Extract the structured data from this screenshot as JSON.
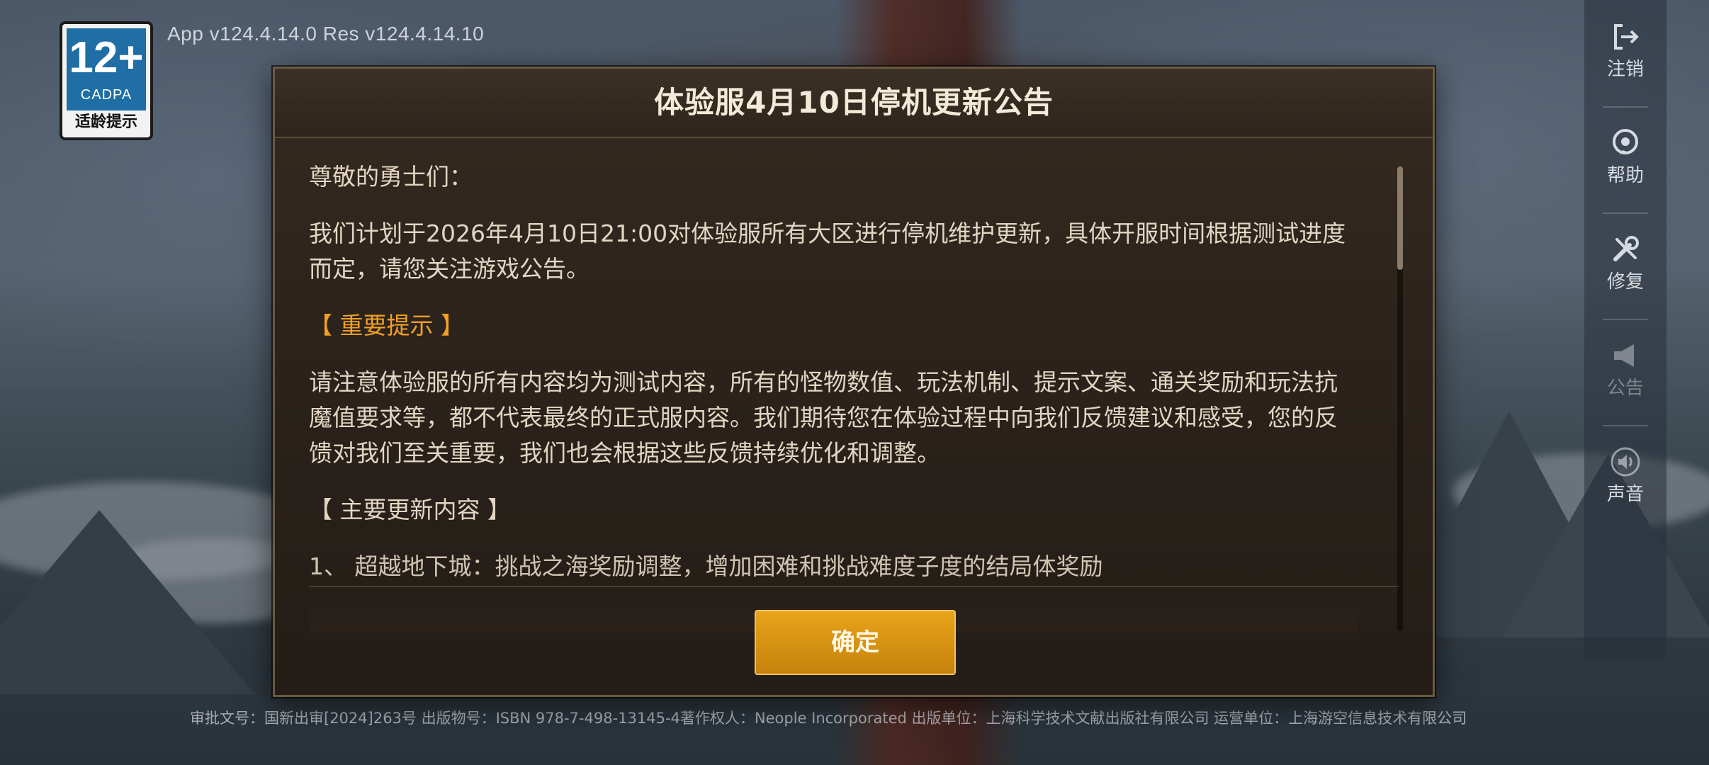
{
  "age_badge": {
    "rating": "12+",
    "org": "CADPA",
    "label": "适龄提示"
  },
  "version_text": "App v124.4.14.0 Res v124.4.14.10",
  "side_menu": [
    {
      "label": "注销",
      "icon": "logout-icon"
    },
    {
      "label": "帮助",
      "icon": "help-icon"
    },
    {
      "label": "修复",
      "icon": "repair-icon"
    },
    {
      "label": "公告",
      "icon": "announcement-icon"
    },
    {
      "label": "声音",
      "icon": "sound-icon"
    }
  ],
  "dialog": {
    "title": "体验服4月10日停机更新公告",
    "greeting": "尊敬的勇士们：",
    "intro": "我们计划于2026年4月10日21:00对体验服所有大区进行停机维护更新，具体开服时间根据测试进度而定，请您关注游戏公告。",
    "important_heading": "【 重要提示 】",
    "important_text": "请注意体验服的所有内容均为测试内容，所有的怪物数值、玩法机制、提示文案、通关奖励和玩法抗魔值要求等，都不代表最终的正式服内容。我们期待您在体验过程中向我们反馈建议和感受，您的反馈对我们至关重要，我们也会根据这些反馈持续优化和调整。",
    "updates_heading": "【 主要更新内容 】",
    "partial_line": "1、 超越地下城：挑战之海奖励调整，增加困难和挑战难度子度的结局体奖励",
    "confirm_label": "确定"
  },
  "footer_note": "审批文号：国新出审[2024]263号 出版物号：ISBN 978-7-498-13145-4著作权人：Neople Incorporated 出版单位：上海科学技术文献出版社有限公司 运营单位：上海游空信息技术有限公司",
  "colors": {
    "accent_orange": "#f2a026",
    "button_gold": "#e8a41a",
    "panel_bg": "#2a221b"
  }
}
